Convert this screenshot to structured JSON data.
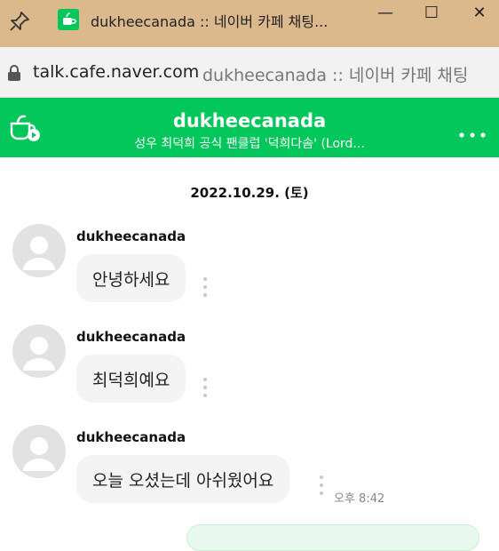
{
  "window": {
    "title": "dukheecanada :: 네이버 카페 채팅...",
    "minimize": "—",
    "maximize": "☐",
    "close": "✕"
  },
  "address_bar": {
    "url": "talk.cafe.naver.com",
    "page_title": "dukheecanada :: 네이버 카페 채팅"
  },
  "header": {
    "room_name": "dukheecanada",
    "subtitle": "성우 최덕희 공식 팬클럽 '덕희다솜' (Lord..."
  },
  "chat": {
    "date": "2022.10.29. (토)",
    "messages": [
      {
        "sender": "dukheecanada",
        "text": "안녕하세요"
      },
      {
        "sender": "dukheecanada",
        "text": "최덕희예요"
      },
      {
        "sender": "dukheecanada",
        "text": "오늘 오셨는데 아쉬웠어요",
        "time": "오후 8:42"
      }
    ]
  },
  "colors": {
    "accent": "#03c75a",
    "titlebar": "#dcb98d"
  }
}
